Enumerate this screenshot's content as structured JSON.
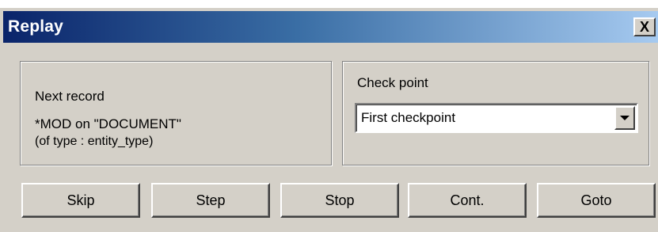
{
  "window": {
    "title": "Replay",
    "close_label": "X"
  },
  "next_record": {
    "label": "Next record",
    "operation": "*MOD on \"DOCUMENT\"",
    "type_info": "(of type : entity_type)"
  },
  "check_point": {
    "label": "Check point",
    "selected": "First checkpoint",
    "arrow_icon": "chevron-down-icon"
  },
  "buttons": {
    "skip": "Skip",
    "step": "Step",
    "stop": "Stop",
    "cont": "Cont.",
    "goto": "Goto"
  }
}
